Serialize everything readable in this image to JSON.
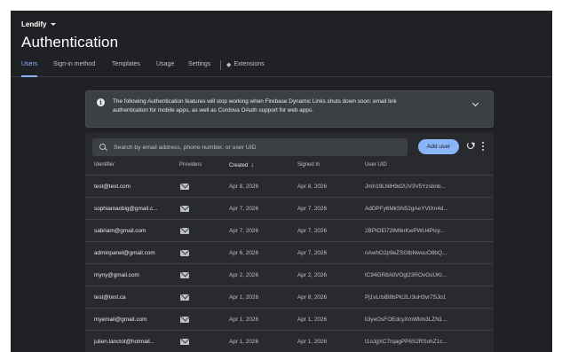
{
  "app": {
    "project_name": "Lendify"
  },
  "page": {
    "title": "Authentication"
  },
  "tabs": [
    {
      "label": "Users",
      "active": true
    },
    {
      "label": "Sign-in method"
    },
    {
      "label": "Templates"
    },
    {
      "label": "Usage"
    },
    {
      "label": "Settings"
    },
    {
      "label": "Extensions",
      "icon": "extensions-icon"
    }
  ],
  "banner": {
    "icon": "info-icon",
    "line1": "The following Authentication features will stop working when Firebase Dynamic Links shuts down soon: email link",
    "line2": "authentication for mobile apps, as well as Cordova OAuth support for web apps."
  },
  "search": {
    "placeholder": "Search by email address, phone number, or user UID"
  },
  "toolbar": {
    "add_user_label": "Add user"
  },
  "table": {
    "columns": [
      "Identifier",
      "Providers",
      "Created",
      "Signed In",
      "User UID"
    ],
    "sort_arrow": "↓",
    "rows": [
      {
        "identifier": "test@test.com",
        "provider": "mail-icon",
        "created": "Apr 8, 2026",
        "signed_in": "Apr 8, 2026",
        "uid": "Jmh19LNlH9d2UV3V5Yzsbnb..."
      },
      {
        "identifier": "sophiamacbig@gmail.c...",
        "provider": "mail-icon",
        "created": "Apr 7, 2026",
        "signed_in": "Apr 7, 2026",
        "uid": "AdDPFy6MkSN52gAeYVtXn4d..."
      },
      {
        "identifier": "sabriam@gmail.com",
        "provider": "mail-icon",
        "created": "Apr 7, 2026",
        "signed_in": "Apr 7, 2026",
        "uid": "2BPlOEi72tM6nKwPWU4Plcy..."
      },
      {
        "identifier": "adminpanel@gmail.com",
        "provider": "mail-icon",
        "created": "Apr 6, 2026",
        "signed_in": "Apr 7, 2026",
        "uid": "nAwhO2p9eZSGtbNwuuO8bQ..."
      },
      {
        "identifier": "myny@gmail.com",
        "provider": "mail-icon",
        "created": "Apr 2, 2026",
        "signed_in": "Apr 2, 2026",
        "uid": "tC94GR8AtlVOgl23ROvGsUKl..."
      },
      {
        "identifier": "test@test.ca",
        "provider": "mail-icon",
        "created": "Apr 1, 2026",
        "signed_in": "Apr 8, 2026",
        "uid": "Pj1vLrbiB8bPlc2Lr3uH3vr7SJo1"
      },
      {
        "identifier": "myemail@gmail.com",
        "provider": "mail-icon",
        "created": "Apr 1, 2026",
        "signed_in": "Apr 1, 2026",
        "uid": "li3yeOsFOEdcyXmWkln3LZN1..."
      },
      {
        "identifier": "julien.lanctot@hotmail...",
        "provider": "mail-icon",
        "created": "Apr 1, 2026",
        "signed_in": "Apr 1, 2026",
        "uid": "t1oJgXC7rqagPP6S2RSohZ1c..."
      }
    ]
  },
  "colors": {
    "background": "#202124",
    "panel": "#292a2d",
    "accent": "#8ab4f8"
  }
}
